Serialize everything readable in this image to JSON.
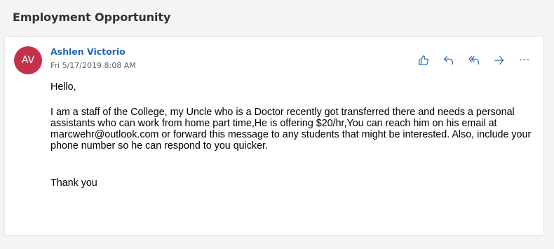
{
  "subject": "Employment Opportunity",
  "message": {
    "avatar_initials": "AV",
    "sender": "Ashlen Victorio",
    "date": "Fri 5/17/2019 8:08 AM",
    "greeting": "Hello,",
    "body": "I am a staff of the College, my Uncle who is a Doctor recently got transferred there and needs a personal assistants who can work from home part time,He is offering $20/hr,You can reach him on his email at marcwehr@outlook.com or forward this message to any students that might be interested. Also, include your phone number so he can respond to you quicker.",
    "closing": "Thank you"
  },
  "actions": [
    {
      "name": "like-icon"
    },
    {
      "name": "reply-icon"
    },
    {
      "name": "reply-all-icon"
    },
    {
      "name": "forward-icon"
    },
    {
      "name": "more-options-icon",
      "glyph": "···"
    }
  ],
  "colors": {
    "avatar_bg": "#c4314b",
    "accent": "#2266b5",
    "background": "#f5f4f3"
  }
}
